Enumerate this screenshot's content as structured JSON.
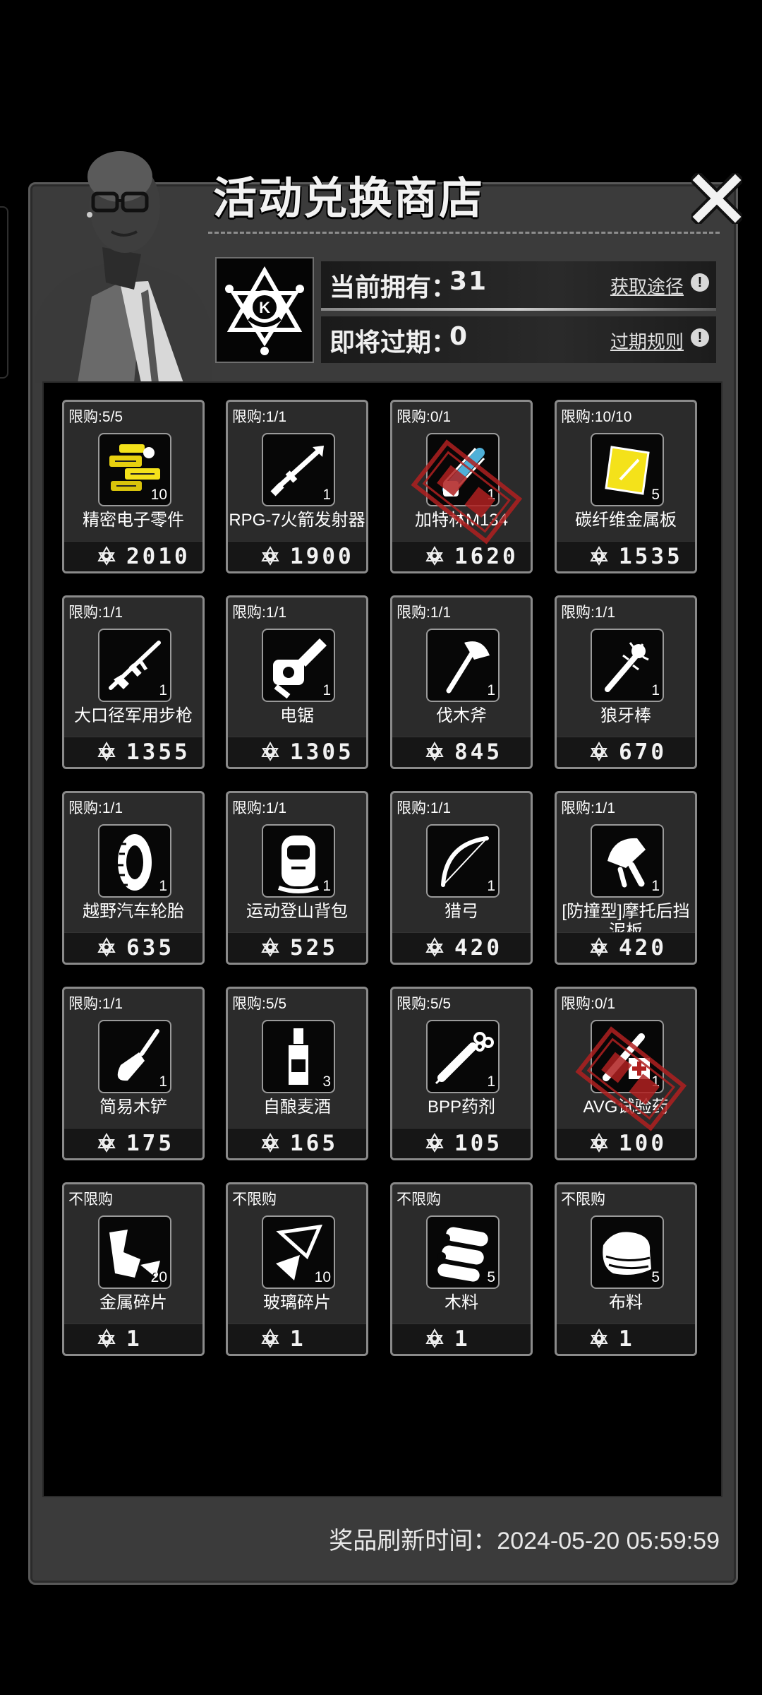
{
  "header": {
    "title": "活动兑换商店",
    "close_icon": "close-icon"
  },
  "currency": {
    "owned_label": "当前拥有：",
    "owned_value": "31",
    "obtain_link": "获取途径",
    "expiring_label": "即将过期：",
    "expiring_value": "0",
    "expire_rule_link": "过期规则",
    "coin_icon": "k-emblem-coin-icon"
  },
  "items": [
    {
      "limit": "限购:5/5",
      "name": "精密电子零件",
      "qty": "10",
      "price": "2010",
      "icon": "electronic-parts-icon",
      "sold_out": false
    },
    {
      "limit": "限购:1/1",
      "name": "RPG-7火箭发射器",
      "qty": "1",
      "price": "1900",
      "icon": "rocket-launcher-icon",
      "sold_out": false
    },
    {
      "limit": "限购:0/1",
      "name": "加特林M134",
      "qty": "1",
      "price": "1620",
      "icon": "gatling-gun-icon",
      "sold_out": true
    },
    {
      "limit": "限购:10/10",
      "name": "碳纤维金属板",
      "qty": "5",
      "price": "1535",
      "icon": "carbon-plate-icon",
      "sold_out": false
    },
    {
      "limit": "限购:1/1",
      "name": "大口径军用步枪",
      "qty": "1",
      "price": "1355",
      "icon": "rifle-icon",
      "sold_out": false
    },
    {
      "limit": "限购:1/1",
      "name": "电锯",
      "qty": "1",
      "price": "1305",
      "icon": "chainsaw-icon",
      "sold_out": false
    },
    {
      "limit": "限购:1/1",
      "name": "伐木斧",
      "qty": "1",
      "price": "845",
      "icon": "axe-icon",
      "sold_out": false
    },
    {
      "limit": "限购:1/1",
      "name": "狼牙棒",
      "qty": "1",
      "price": "670",
      "icon": "spiked-club-icon",
      "sold_out": false
    },
    {
      "limit": "限购:1/1",
      "name": "越野汽车轮胎",
      "qty": "1",
      "price": "635",
      "icon": "tire-icon",
      "sold_out": false
    },
    {
      "limit": "限购:1/1",
      "name": "运动登山背包",
      "qty": "1",
      "price": "525",
      "icon": "backpack-icon",
      "sold_out": false
    },
    {
      "limit": "限购:1/1",
      "name": "猎弓",
      "qty": "1",
      "price": "420",
      "icon": "bow-icon",
      "sold_out": false
    },
    {
      "limit": "限购:1/1",
      "name": "[防撞型]摩托后挡泥板",
      "qty": "1",
      "price": "420",
      "icon": "fender-icon",
      "sold_out": false
    },
    {
      "limit": "限购:1/1",
      "name": "简易木铲",
      "qty": "1",
      "price": "175",
      "icon": "shovel-icon",
      "sold_out": false
    },
    {
      "limit": "限购:5/5",
      "name": "自酿麦酒",
      "qty": "3",
      "price": "165",
      "icon": "bottle-icon",
      "sold_out": false
    },
    {
      "limit": "限购:5/5",
      "name": "BPP药剂",
      "qty": "1",
      "price": "105",
      "icon": "syringe-icon",
      "sold_out": false
    },
    {
      "limit": "限购:0/1",
      "name": "AVG试验药",
      "qty": "1",
      "price": "100",
      "icon": "test-medicine-icon",
      "sold_out": true
    },
    {
      "limit": "不限购",
      "name": "金属碎片",
      "qty": "20",
      "price": "1",
      "icon": "metal-scrap-icon",
      "sold_out": false
    },
    {
      "limit": "不限购",
      "name": "玻璃碎片",
      "qty": "10",
      "price": "1",
      "icon": "glass-shard-icon",
      "sold_out": false
    },
    {
      "limit": "不限购",
      "name": "木料",
      "qty": "5",
      "price": "1",
      "icon": "wood-logs-icon",
      "sold_out": false
    },
    {
      "limit": "不限购",
      "name": "布料",
      "qty": "5",
      "price": "1",
      "icon": "cloth-icon",
      "sold_out": false
    }
  ],
  "footer": {
    "refresh_label": "奖品刷新时间：",
    "refresh_time": "2024-05-20 05:59:59"
  },
  "colors": {
    "panel": "#3b3b3b",
    "card": "#2b2b2b",
    "card_border": "#8a8a8a",
    "sold_out_stamp": "#b02020",
    "highlight_yellow": "#f4e21a"
  }
}
